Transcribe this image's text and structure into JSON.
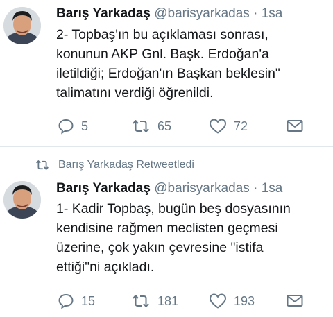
{
  "tweets": [
    {
      "author_name": "Barış Yarkadaş",
      "handle": "@barisyarkadas",
      "separator": "·",
      "time": "1sa",
      "text": "2- Topbaş'ın bu açıklaması sonrası,\nkonunun AKP Gnl. Başk. Erdoğan'a\niletildiği; Erdoğan'ın Başkan beklesin\"\ntalimatını verdiği öğrenildi.",
      "replies": "5",
      "retweets": "65",
      "likes": "72"
    },
    {
      "author_name": "Barış Yarkadaş",
      "handle": "@barisyarkadas",
      "separator": "·",
      "time": "1sa",
      "text": "1- Kadir Topbaş, bugün beş dosyasının\nkendisine rağmen meclisten geçmesi\nüzerine, çok yakın çevresine \"istifa\nettiği\"ni açıkladı.",
      "replies": "15",
      "retweets": "181",
      "likes": "193"
    }
  ],
  "retweet_context": {
    "label": "Barış Yarkadaş Retweetledi",
    "icon": "retweet-icon"
  },
  "icons": {
    "reply": "reply-icon",
    "retweet": "retweet-icon",
    "like": "heart-icon",
    "dm": "envelope-icon"
  },
  "colors": {
    "text": "#14171a",
    "secondary": "#657786",
    "divider": "#e1e8ed"
  }
}
